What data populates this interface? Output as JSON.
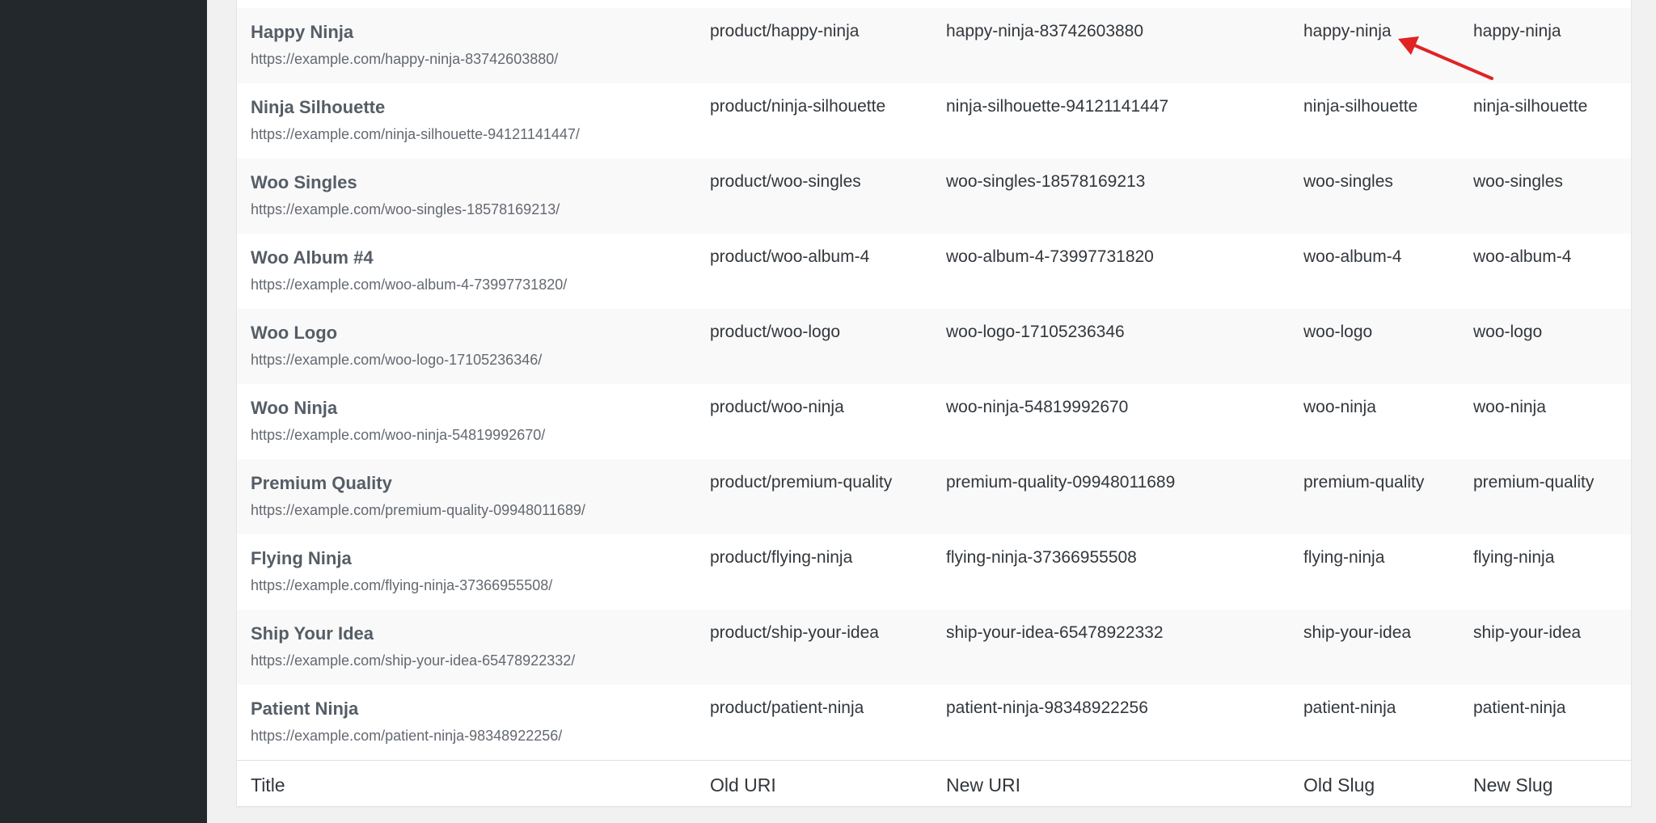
{
  "table": {
    "columns": [
      "Title",
      "Old URI",
      "New URI",
      "Old Slug",
      "New Slug"
    ],
    "rows": [
      {
        "title": "Happy Ninja",
        "url": "https://example.com/happy-ninja-83742603880/",
        "old_uri": "product/happy-ninja",
        "new_uri": "happy-ninja-83742603880",
        "old_slug": "happy-ninja",
        "new_slug": "happy-ninja"
      },
      {
        "title": "Ninja Silhouette",
        "url": "https://example.com/ninja-silhouette-94121141447/",
        "old_uri": "product/ninja-silhouette",
        "new_uri": "ninja-silhouette-94121141447",
        "old_slug": "ninja-silhouette",
        "new_slug": "ninja-silhouette"
      },
      {
        "title": "Woo Singles",
        "url": "https://example.com/woo-singles-18578169213/",
        "old_uri": "product/woo-singles",
        "new_uri": "woo-singles-18578169213",
        "old_slug": "woo-singles",
        "new_slug": "woo-singles"
      },
      {
        "title": "Woo Album #4",
        "url": "https://example.com/woo-album-4-73997731820/",
        "old_uri": "product/woo-album-4",
        "new_uri": "woo-album-4-73997731820",
        "old_slug": "woo-album-4",
        "new_slug": "woo-album-4"
      },
      {
        "title": "Woo Logo",
        "url": "https://example.com/woo-logo-17105236346/",
        "old_uri": "product/woo-logo",
        "new_uri": "woo-logo-17105236346",
        "old_slug": "woo-logo",
        "new_slug": "woo-logo"
      },
      {
        "title": "Woo Ninja",
        "url": "https://example.com/woo-ninja-54819992670/",
        "old_uri": "product/woo-ninja",
        "new_uri": "woo-ninja-54819992670",
        "old_slug": "woo-ninja",
        "new_slug": "woo-ninja"
      },
      {
        "title": "Premium Quality",
        "url": "https://example.com/premium-quality-09948011689/",
        "old_uri": "product/premium-quality",
        "new_uri": "premium-quality-09948011689",
        "old_slug": "premium-quality",
        "new_slug": "premium-quality"
      },
      {
        "title": "Flying Ninja",
        "url": "https://example.com/flying-ninja-37366955508/",
        "old_uri": "product/flying-ninja",
        "new_uri": "flying-ninja-37366955508",
        "old_slug": "flying-ninja",
        "new_slug": "flying-ninja"
      },
      {
        "title": "Ship Your Idea",
        "url": "https://example.com/ship-your-idea-65478922332/",
        "old_uri": "product/ship-your-idea",
        "new_uri": "ship-your-idea-65478922332",
        "old_slug": "ship-your-idea",
        "new_slug": "ship-your-idea"
      },
      {
        "title": "Patient Ninja",
        "url": "https://example.com/patient-ninja-98348922256/",
        "old_uri": "product/patient-ninja",
        "new_uri": "patient-ninja-98348922256",
        "old_slug": "patient-ninja",
        "new_slug": "patient-ninja"
      }
    ]
  },
  "annotation": {
    "arrow_color": "#e02424"
  },
  "colors": {
    "sidebar": "#23282d",
    "background": "#f1f1f1",
    "row_alt": "#f9f9f9"
  }
}
